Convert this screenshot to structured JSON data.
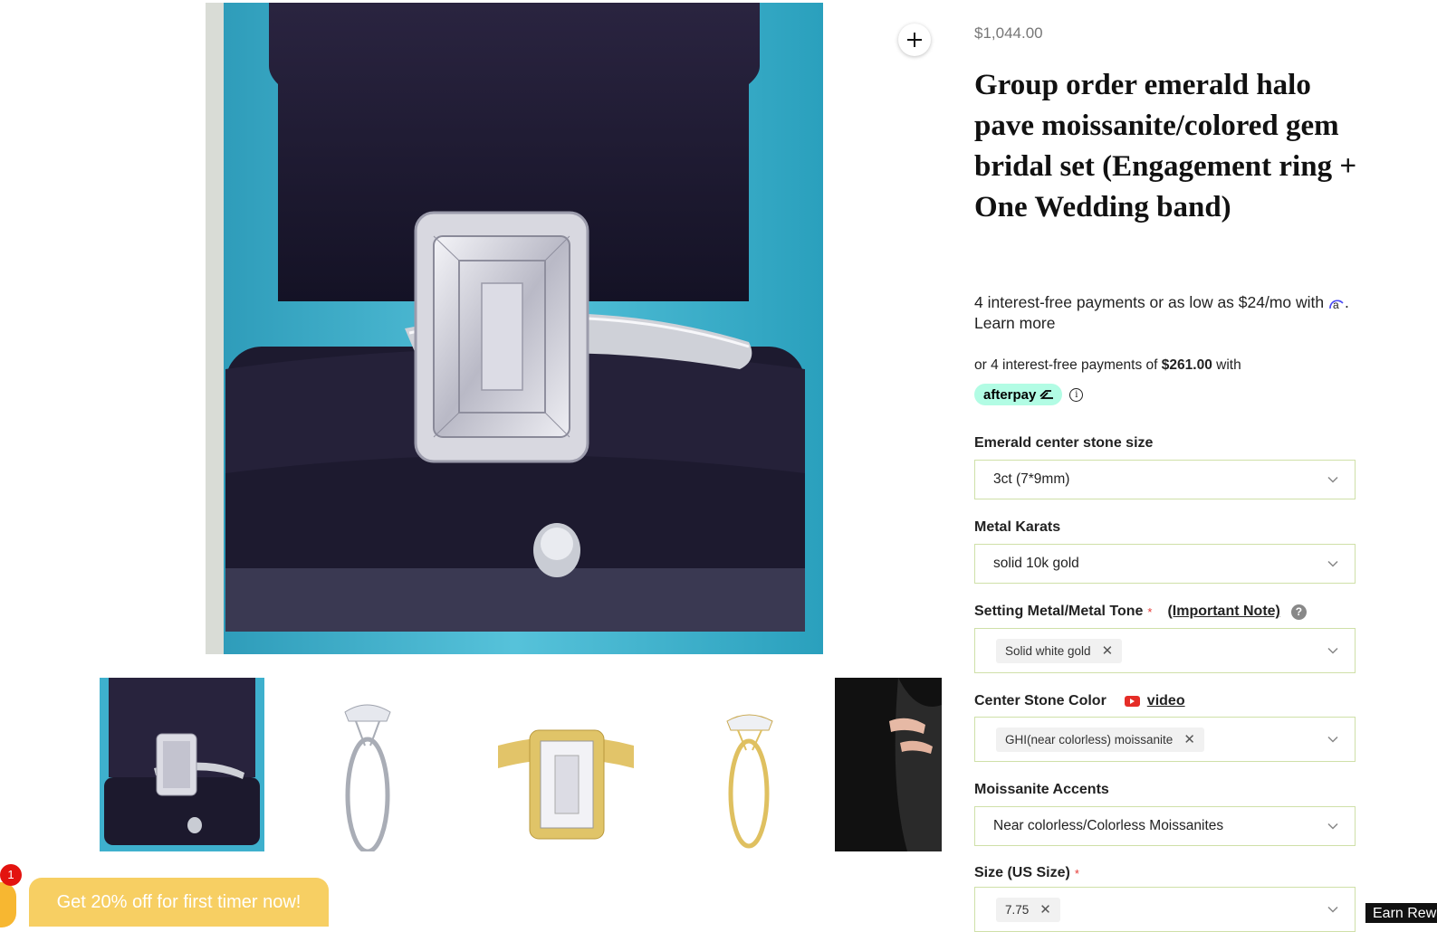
{
  "product": {
    "price": "$1,044.00",
    "title": "Group order emerald halo pave moissanite/colored gem bridal set (Engagement ring + One Wedding band)"
  },
  "gallery": {
    "main_image_icon": "ring-in-box-image",
    "zoom_icon": "plus-icon",
    "thumbnails": [
      {
        "icon": "ring-in-box-thumbnail"
      },
      {
        "icon": "white-gold-ring-side-thumbnail"
      },
      {
        "icon": "yellow-gold-bridal-set-thumbnail"
      },
      {
        "icon": "yellow-gold-ring-side-thumbnail"
      },
      {
        "icon": "hand-model-thumbnail"
      }
    ]
  },
  "financing": {
    "affirm_text": "4 interest-free payments or as low as $24/mo with",
    "affirm_link": ". Learn more",
    "afterpay_prefix": "or 4 interest-free payments of",
    "afterpay_amount": "$261.00",
    "afterpay_suffix": "with",
    "afterpay_badge": "afterpay",
    "info_glyph": "i"
  },
  "options": {
    "center_stone_size": {
      "label": "Emerald center stone size",
      "value": "3ct (7*9mm)"
    },
    "metal_karats": {
      "label": "Metal Karats",
      "value": "solid 10k gold"
    },
    "metal_tone": {
      "label": "Setting Metal/Metal Tone",
      "required_mark": "*",
      "note_link": "(Important Note)",
      "help_glyph": "?",
      "value": "Solid white gold"
    },
    "stone_color": {
      "label": "Center Stone Color",
      "video_link": "video",
      "value": "GHI(near colorless) moissanite"
    },
    "moissanite_accents": {
      "label": "Moissanite Accents",
      "value": "Near colorless/Colorless Moissanites"
    },
    "ring_size": {
      "label": "Size (US Size)",
      "required_mark": "*",
      "value": "7.75"
    },
    "remove_glyph": "✕"
  },
  "promo": {
    "text": "Get 20% off for first timer now!",
    "badge_count": "1"
  },
  "rewards": {
    "label": "Earn Rewards"
  },
  "colors": {
    "accent_border": "#cfe0a8",
    "afterpay": "#b2fce4",
    "promo": "#f7cf63",
    "badge": "#e3130f"
  }
}
